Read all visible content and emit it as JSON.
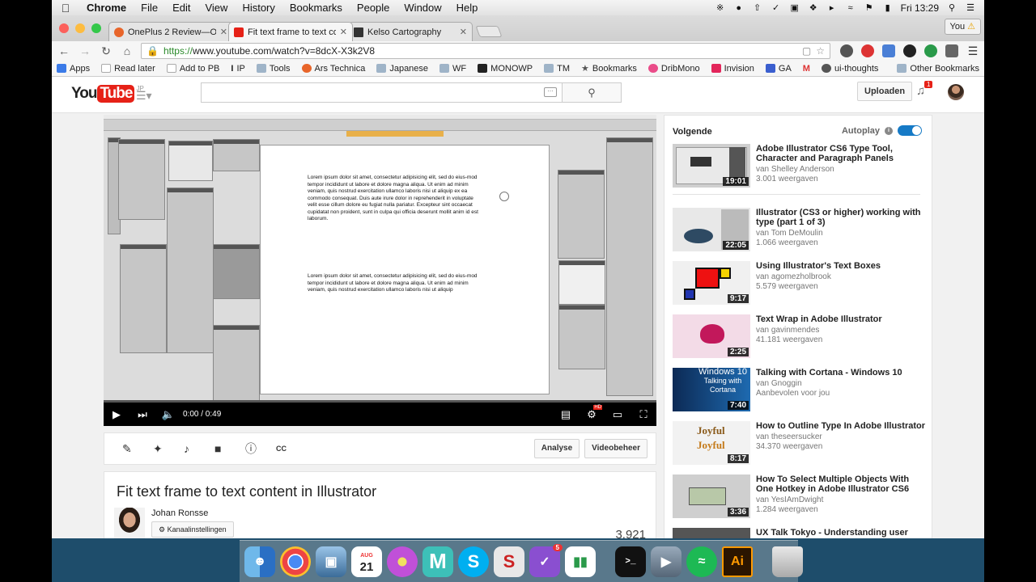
{
  "menubar": {
    "app": "Chrome",
    "items": [
      "File",
      "Edit",
      "View",
      "History",
      "Bookmarks",
      "People",
      "Window",
      "Help"
    ],
    "clock": "Fri 13:29"
  },
  "tabs": [
    {
      "title": "OnePlus 2 Review—OnePl",
      "color": "#e8652a"
    },
    {
      "title": "Fit text frame to text co",
      "color": "#e62117"
    },
    {
      "title": "Kelso Cartography",
      "color": "#333333"
    }
  ],
  "profile": "You",
  "url": {
    "scheme": "https://",
    "rest": "www.youtube.com/watch?v=8dcX-X3k2V8"
  },
  "bookmarks": [
    {
      "label": "Apps",
      "icon": "apps-grid"
    },
    {
      "label": "Read later",
      "icon": "page"
    },
    {
      "label": "Add to PB",
      "icon": "page"
    },
    {
      "label": "IP",
      "icon": "text-cursor"
    },
    {
      "label": "Tools",
      "icon": "folder"
    },
    {
      "label": "Ars Technica",
      "icon": "ars"
    },
    {
      "label": "Japanese",
      "icon": "folder"
    },
    {
      "label": "WF",
      "icon": "folder"
    },
    {
      "label": "MONOWP",
      "icon": "monowp"
    },
    {
      "label": "TM",
      "icon": "folder"
    },
    {
      "label": "Bookmarks",
      "icon": "star"
    },
    {
      "label": "DribMono",
      "icon": "dribbble"
    },
    {
      "label": "Invision",
      "icon": "invision"
    },
    {
      "label": "GA",
      "icon": "ga"
    },
    {
      "label": "",
      "icon": "gmail"
    },
    {
      "label": "ui-thoughts",
      "icon": "github"
    }
  ],
  "other_bookmarks": "Other Bookmarks",
  "youtube": {
    "logo_you": "You",
    "logo_tube": "Tube",
    "logo_region": "JP",
    "search_placeholder": "",
    "upload_label": "Uploaden",
    "notification_count": "1"
  },
  "player": {
    "time": "0:00 / 0:49",
    "progress": 0,
    "lorem1": "Lorem ipsum dolor sit amet, consectetur adipisicing elit, sed do eius-mod tempor incididunt ut labore et dolore magna aliqua. Ut enim ad minim veniam, quis nostrud exercitation ullamco laboris nisi ut aliquip ex ea commodo consequat. Duis aute irure dolor in reprehenderit in voluptate velit esse cillum dolore eu fugiat nulla pariatur. Excepteur sint occaecat cupidatat non proident, sunt in culpa qui officia deserunt mollit anim id est laborum.",
    "lorem2": "Lorem ipsum dolor sit amet, consectetur adipisicing elit, sed do eius-mod tempor incididunt ut labore et dolore magna aliqua. Ut enim ad minim veniam, quis nostrud exercitation ullamco laboris nisi ut aliquip"
  },
  "actions": {
    "analyse": "Analyse",
    "videobeheer": "Videobeheer"
  },
  "video": {
    "title": "Fit text frame to text content in Illustrator",
    "owner": "Johan Ronsse",
    "channel_settings": "Kanaalinstellingen",
    "views": "3.921"
  },
  "sidebar": {
    "next_label": "Volgende",
    "autoplay_label": "Autoplay",
    "videos": [
      {
        "title": "Adobe Illustrator CS6 Type Tool, Character and Paragraph Panels",
        "channel": "van Shelley Anderson",
        "views": "3.001 weergaven",
        "duration": "19:01"
      },
      {
        "title": "Illustrator (CS3 or higher) working with type (part 1 of 3)",
        "channel": "van Tom DeMoulin",
        "views": "1.066 weergaven",
        "duration": "22:05"
      },
      {
        "title": "Using Illustrator's Text Boxes",
        "channel": "van agomezholbrook",
        "views": "5.579 weergaven",
        "duration": "9:17"
      },
      {
        "title": "Text Wrap in Adobe Illustrator",
        "channel": "van gavinmendes",
        "views": "41.181 weergaven",
        "duration": "2:25"
      },
      {
        "title": "Talking with Cortana - Windows 10",
        "channel": "van Gnoggin",
        "views": "Aanbevolen voor jou",
        "duration": "7:40"
      },
      {
        "title": "How to Outline Type In Adobe Illustrator",
        "channel": "van theseersucker",
        "views": "34.370 weergaven",
        "duration": "8:17"
      },
      {
        "title": "How To Select Multiple Objects With One Hotkey in Adobe Illustrator CS6",
        "channel": "van YesIAmDwight",
        "views": "1.284 weergaven",
        "duration": "3:36"
      },
      {
        "title": "UX Talk Tokyo - Understanding user",
        "channel": "",
        "views": "",
        "duration": ""
      }
    ],
    "thumb_text": {
      "windows10": "Windows 10",
      "talking": "Talking with",
      "cortana": "Cortana",
      "joyful": "Joyful"
    }
  },
  "dock": {
    "calendar_month": "AUG",
    "calendar_day": "21",
    "todo_badge": "5",
    "illustrator": "Ai",
    "terminal": ">_"
  }
}
